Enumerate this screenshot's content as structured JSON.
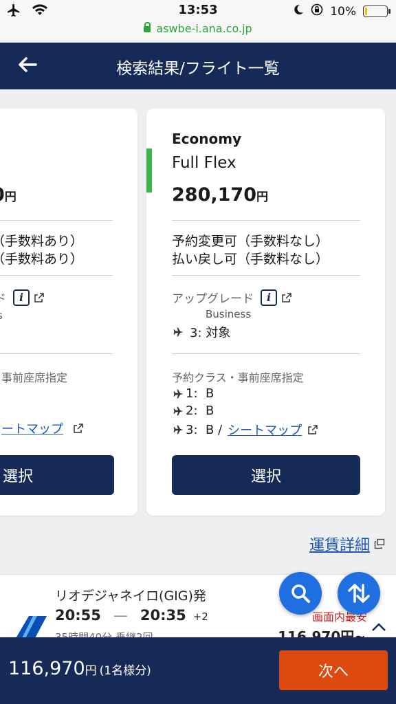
{
  "status_bar": {
    "time": "13:53",
    "battery": "10%",
    "battery_level": 0.1,
    "url": "aswbe-i.ana.co.jp",
    "icons": [
      "airplane-mode-icon",
      "wifi-icon",
      "moon-icon",
      "rotation-lock-icon",
      "battery-icon"
    ]
  },
  "header": {
    "title": "検索結果/フライト一覧",
    "back_icon": "arrow-left-icon"
  },
  "cards": {
    "left_partial": {
      "price_fragment": "0",
      "price_unit": "円",
      "conditions": [
        "（手数料あり）",
        "（手数料あり）"
      ],
      "upgrade_fragment": "ド",
      "upgrade_sub_fragment": "s",
      "seat_label_fragment": "事前座席指定",
      "seat_map_fragment": "ートマップ",
      "select_label": "選択"
    },
    "right": {
      "cabin_class": "Economy",
      "fare_type": "Full Flex",
      "price": "280,170",
      "price_unit": "円",
      "conditions": [
        "予約変更可（手数料なし）",
        "払い戻し可（手数料なし）"
      ],
      "upgrade_label": "アップグレード",
      "upgrade_class": "Business",
      "upgrade_row": "3: 対象",
      "seat_label": "予約クラス・事前座席指定",
      "seat_rows": [
        "1:  B",
        "2:  B",
        "3:  B /"
      ],
      "seat_map_link": "シートマップ",
      "select_label": "選択"
    }
  },
  "fare_detail_link": "運賃詳細",
  "bottom_flight": {
    "origin": "リオデジャネイロ(GIG)発",
    "depart_time": "20:55",
    "dash": "—",
    "arrive_time": "20:35",
    "day_offset": "+2",
    "duration": "35時間40分 乗継2回",
    "lowest_label": "画面内最安",
    "price": "116,970円~"
  },
  "footer": {
    "total_price": "116,970",
    "total_unit": "円",
    "per_person": "(1名様分)",
    "next_label": "次へ"
  },
  "colors": {
    "navy": "#152a57",
    "accent_orange": "#dd4a0f",
    "fab_blue": "#1f6fe0",
    "green_bar": "#3cb54a",
    "link_blue": "#1d56b8",
    "url_green": "#2aa53a"
  }
}
